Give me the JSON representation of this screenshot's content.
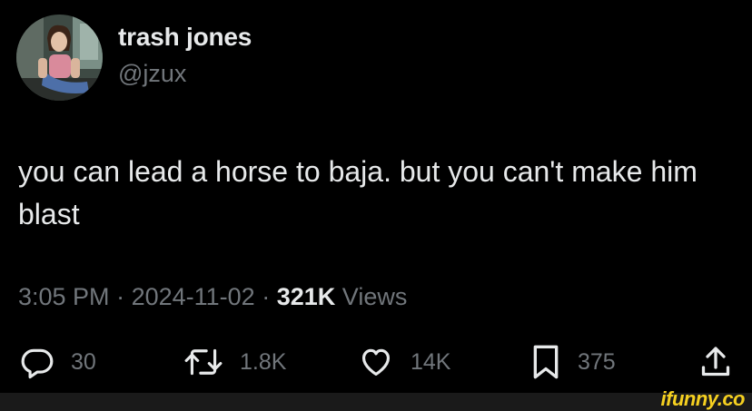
{
  "author": {
    "name": "trash jones",
    "handle": "@jzux"
  },
  "tweet": {
    "text": "you can lead a horse to baja. but you can't make him blast"
  },
  "meta": {
    "time": "3:05 PM",
    "separator": "·",
    "date": "2024-11-02",
    "views_count": "321K",
    "views_label": "Views"
  },
  "actions": {
    "replies": "30",
    "reposts": "1.8K",
    "likes": "14K",
    "bookmarks": "375"
  },
  "icons": {
    "reply": "reply-icon",
    "repost": "repost-icon",
    "like": "heart-icon",
    "bookmark": "bookmark-icon",
    "share": "share-icon"
  },
  "watermark": {
    "text": "ifunny.co"
  },
  "colors": {
    "background": "#000000",
    "primary_text": "#e7e9ea",
    "secondary_text": "#71767b",
    "watermark": "#f5d020"
  }
}
